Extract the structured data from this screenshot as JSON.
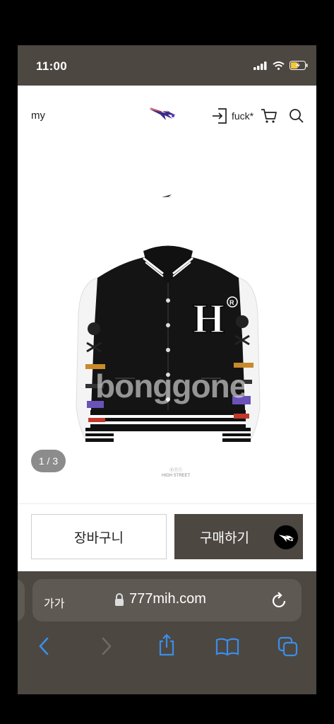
{
  "status_bar": {
    "time": "11:00",
    "icons": [
      "signal-icon",
      "wifi-icon",
      "battery-charging-icon"
    ]
  },
  "header": {
    "nav_left": "my",
    "user_label": "fuck*",
    "icons": [
      "login-icon",
      "cart-icon",
      "search-icon"
    ]
  },
  "gallery": {
    "page_indicator": "1 / 3",
    "watermark": "bonggone",
    "tag_text": "ⓔⓕⓘ\nHIGH STREET"
  },
  "purchase": {
    "cart_label": "장바구니",
    "buy_label": "구매하기"
  },
  "browser": {
    "aa_label": "가가",
    "url": "777mih.com",
    "toolbar": [
      "back-icon",
      "forward-icon",
      "share-icon",
      "bookmarks-icon",
      "tabs-icon"
    ]
  },
  "colors": {
    "dark_bar": "#4c4741",
    "accent_blue": "#3b8eea",
    "page_bg": "#ffffff"
  }
}
